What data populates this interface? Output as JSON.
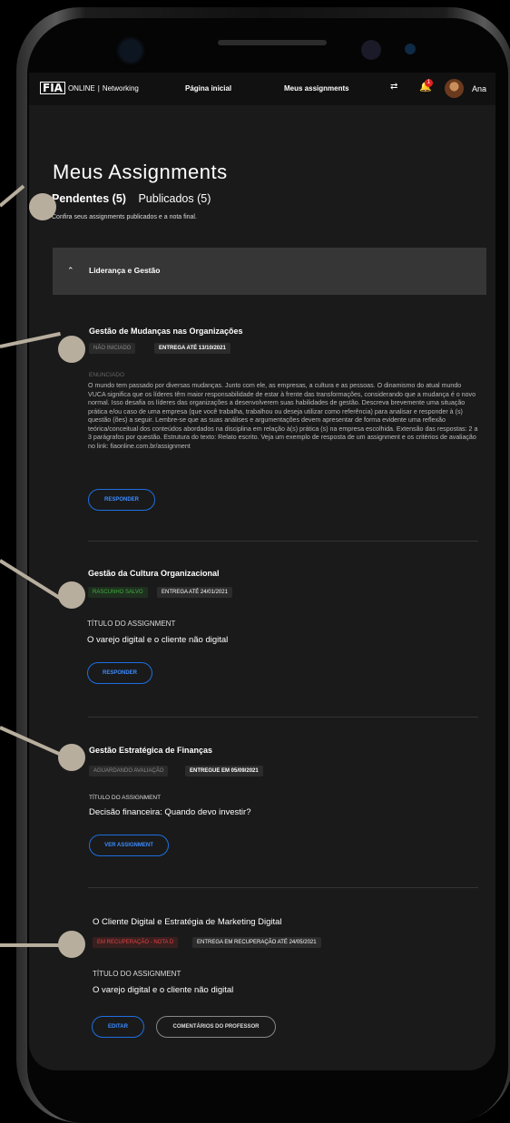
{
  "nav": {
    "logo_mark": "FIA",
    "logo_text": "ONLINE",
    "sep": "|",
    "networking": "Networking",
    "home": "Página inicial",
    "assignments": "Meus assignments",
    "notif_count": "1",
    "user": "Ana"
  },
  "page": {
    "title": "Meus Assignments",
    "tab_pending": "Pendentes (5)",
    "tab_published": "Publicados (5)",
    "subtitle": "Confira seus assignments publicados e a nota final."
  },
  "section": {
    "label": "Liderança e Gestão"
  },
  "cards": [
    {
      "title": "Gestão de Mudanças nas Organizações",
      "status": "NÃO INICIADO",
      "deadline": "ENTREGA ATÉ 13/10/2021",
      "label": "ENUNCIADO",
      "body": "O mundo tem passado por diversas mudanças. Junto com ele, as empresas, a cultura e as pessoas. O dinamismo do atual mundo VUCA significa que os líderes têm maior responsabilidade de estar à frente das transformações, considerando que a mudança é o novo normal. Isso desafia os líderes das organizações a desenvolverem suas habilidades de gestão. Descreva brevemente uma situação prática e/ou caso de uma empresa (que você trabalha, trabalhou ou deseja utilizar como referência) para analisar e responder à (s) questão (ões) a seguir. Lembre-se que as suas análises e argumentações devem apresentar de forma evidente uma reflexão teórica/conceitual dos conteúdos abordados na disciplina em relação à(s) prática (s) na empresa escolhida. Extensão das respostas: 2 a 3 parágrafos por questão. Estrutura do texto: Relato escrito. Veja um exemplo de resposta de um assignment e os critérios de avaliação no link: fiaonline.com.br/assignment",
      "button": "RESPONDER"
    },
    {
      "title": "Gestão da Cultura Organizacional",
      "status": "RASCUNHO SALVO",
      "deadline": "ENTREGA ATÉ 24/01/2021",
      "field_label": "TÍTULO DO ASSIGNMENT",
      "field_value": "O varejo digital e o cliente não digital",
      "button": "RESPONDER"
    },
    {
      "title": "Gestão Estratégica de Finanças",
      "status": "AGUARDANDO AVALIAÇÃO",
      "deadline": "ENTREGUE EM 05/09/2021",
      "field_label": "TÍTULO DO ASSIGNMENT",
      "field_value": "Decisão financeira: Quando devo investir?",
      "button": "VER ASSIGNMENT"
    },
    {
      "title": "O Cliente Digital e Estratégia de Marketing Digital",
      "status": "EM RECUPERAÇÃO - NOTA D",
      "deadline": "ENTREGA EM RECUPERAÇÃO ATÉ 24/05/2021",
      "field_label": "TÍTULO DO ASSIGNMENT",
      "field_value": "O varejo digital e o cliente não digital",
      "button": "EDITAR",
      "button2": "COMENTÁRIOS DO PROFESSOR"
    }
  ],
  "colors": {
    "accent_blue": "#1e6fe0",
    "green": "#3fae3f",
    "red": "#e04040",
    "callout": "#b8ae9e"
  }
}
